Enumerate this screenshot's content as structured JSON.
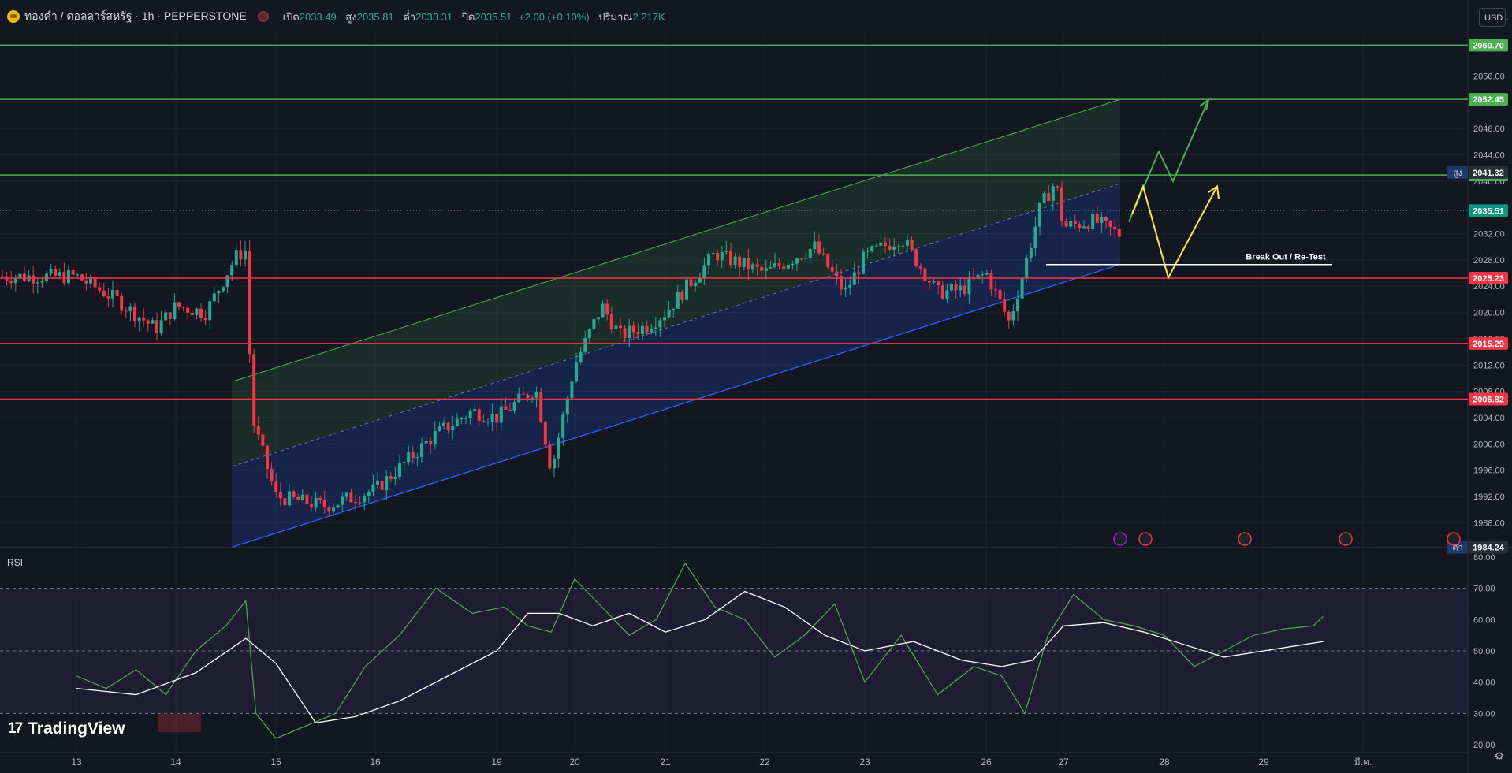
{
  "header": {
    "symbol_title": "ทองคำ / ดอลลาร์สหรัฐ · 1h · PEPPERSTONE",
    "open_label": "เปิด",
    "open_value": "2033.49",
    "high_label": "สูง",
    "high_value": "2035.81",
    "low_label": "ต่ำ",
    "low_value": "2033.31",
    "close_label": "ปิด",
    "close_value": "2035.51",
    "change_value": "+2.00 (+0.10%)",
    "volume_label": "ปริมาณ",
    "volume_value": "2.217K",
    "currency": "USD"
  },
  "colors": {
    "bg": "#131722",
    "up": "#22ab94",
    "down": "#f23645",
    "green_line": "#4caf50",
    "red_line": "#f23645",
    "yellow": "#ffeb3b",
    "channel_upper": "#4caf50",
    "channel_lower": "#2962ff",
    "rsi": "#4caf50",
    "rsi_ma": "#ffffff"
  },
  "brand": "TradingView",
  "rsi_label": "RSI",
  "chart_data": [
    {
      "type": "candlestick",
      "title": "ทองคำ / ดอลลาร์สหรัฐ · 1h · PEPPERSTONE",
      "y_axis_ticks": [
        "2056.00",
        "2048.00",
        "2044.00",
        "2040.00",
        "2032.00",
        "2028.00",
        "2024.00",
        "2020.00",
        "2016.00",
        "2012.00",
        "2008.00",
        "2004.00",
        "2000.00",
        "1996.00",
        "1992.00",
        "1988.00"
      ],
      "x_axis_ticks": [
        "13",
        "14",
        "15",
        "16",
        "19",
        "20",
        "21",
        "22",
        "23",
        "26",
        "27",
        "28",
        "29",
        "มี.ค."
      ],
      "ylim": [
        1984.2,
        2062.3
      ],
      "horizontal_levels": [
        {
          "price": 2060.7,
          "label": "2060.70",
          "color": "#4caf50"
        },
        {
          "price": 2052.45,
          "label": "2052.45",
          "color": "#4caf50"
        },
        {
          "price": 2040.93,
          "label": "2040.93",
          "color": "#4caf50"
        },
        {
          "price": 2025.23,
          "label": "2025.23",
          "color": "#f23645"
        },
        {
          "price": 2015.29,
          "label": "2015.29",
          "color": "#f23645"
        },
        {
          "price": 2006.82,
          "label": "2006.82",
          "color": "#f23645"
        }
      ],
      "price_tags": [
        {
          "price": 2041.32,
          "label": "2041.32",
          "prefix": "สูง"
        },
        {
          "price": 2035.51,
          "label": "2035.51",
          "kind": "last"
        },
        {
          "price": 1984.24,
          "label": "1984.24",
          "prefix": "ต่ำ"
        }
      ],
      "annotations": [
        "Break Out / Re-Test"
      ],
      "series": [
        {
          "name": "close",
          "x": [
            0,
            0.4,
            0.8,
            1,
            1.3,
            1.6,
            1.7,
            1.76,
            2,
            2.5,
            3,
            3.5,
            3.8,
            4,
            4.5,
            4.7,
            5,
            5.3,
            5.5,
            5.8,
            6,
            6.5,
            7,
            7.5,
            7.8,
            8,
            8.3,
            8.6,
            8.8,
            9,
            9.3,
            9.5,
            9.7,
            9.9,
            10,
            10.3,
            10.6,
            10.9,
            11.2,
            11.4,
            11.6,
            11.8,
            12,
            12.2,
            12.4,
            12.6
          ],
          "values": [
            2025.5,
            2022.0,
            2017.5,
            2021.0,
            2020.0,
            2028.5,
            2029.5,
            2004.0,
            1992.0,
            1990.5,
            1993.0,
            2001.5,
            2005.0,
            2004.0,
            2008.5,
            1996.0,
            2012.0,
            2021.0,
            2016.5,
            2018.0,
            2020.0,
            2029.0,
            2026.0,
            2030.0,
            2023.0,
            2028.5,
            2031.5,
            2023.0,
            2023.5,
            2026.0,
            2018.5,
            2027.0,
            2036.0,
            2040.0,
            2033.0,
            2034.0,
            2031.5,
            2034.0,
            2027.0,
            2029.0,
            2030.5,
            2032.5,
            2034.0,
            2033.5,
            2034.5,
            2035.51
          ]
        }
      ]
    },
    {
      "type": "line",
      "title": "RSI",
      "y_axis_ticks": [
        "80.00",
        "70.00",
        "60.00",
        "50.00",
        "40.00",
        "30.00",
        "20.00"
      ],
      "ylim": [
        17.5,
        82.5
      ],
      "bands": [
        30,
        50,
        70
      ],
      "series": [
        {
          "name": "RSI",
          "x": [
            0,
            0.3,
            0.6,
            0.9,
            1.2,
            1.5,
            1.7,
            1.8,
            2.0,
            2.3,
            2.6,
            2.9,
            3.2,
            3.5,
            3.8,
            4.1,
            4.4,
            4.7,
            5.0,
            5.3,
            5.6,
            5.9,
            6.2,
            6.5,
            6.8,
            7.1,
            7.4,
            7.7,
            8.0,
            8.3,
            8.6,
            8.9,
            9.2,
            9.5,
            9.8,
            10.1,
            10.4,
            10.7,
            11.0,
            11.3,
            11.6,
            11.9,
            12.2,
            12.5,
            12.6
          ],
          "values": [
            42,
            38,
            44,
            36,
            50,
            58,
            66,
            30,
            22,
            26,
            30,
            45,
            55,
            70,
            62,
            64,
            58,
            56,
            73,
            64,
            55,
            60,
            78,
            64,
            60,
            48,
            55,
            65,
            40,
            55,
            36,
            45,
            42,
            30,
            55,
            68,
            60,
            58,
            55,
            45,
            50,
            55,
            57,
            58,
            61
          ]
        },
        {
          "name": "RSI-MA",
          "x": [
            0,
            0.6,
            1.2,
            1.7,
            2.0,
            2.4,
            2.8,
            3.2,
            3.6,
            4.0,
            4.4,
            4.8,
            5.2,
            5.6,
            6.0,
            6.4,
            6.8,
            7.2,
            7.6,
            8.0,
            8.4,
            8.8,
            9.2,
            9.6,
            10.0,
            10.4,
            10.8,
            11.2,
            11.6,
            12.0,
            12.6
          ],
          "values": [
            38,
            36,
            43,
            54,
            46,
            27,
            29,
            34,
            42,
            50,
            62,
            62,
            58,
            62,
            56,
            60,
            69,
            64,
            55,
            50,
            53,
            47,
            45,
            47,
            58,
            59,
            56,
            52,
            48,
            50,
            53
          ]
        }
      ]
    }
  ]
}
